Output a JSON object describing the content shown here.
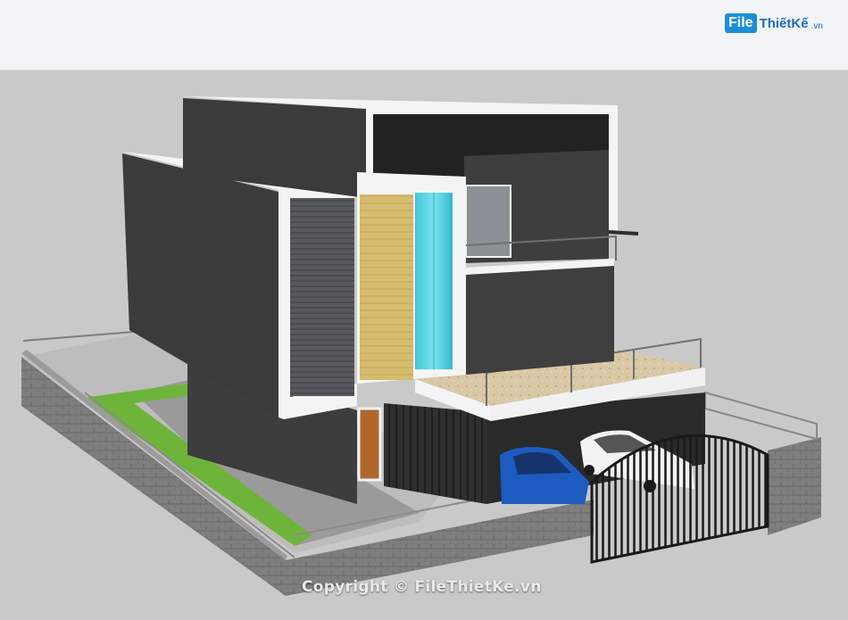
{
  "logo": {
    "box": "File",
    "name": "ThiếtKế",
    "suffix": ".vn"
  },
  "watermark": "Copyright © FileThietKe.vn",
  "colors": {
    "background": "#c9c9c9",
    "wall_dark": "#3d3d3d",
    "frame_white": "#f4f4f4",
    "lawn_green": "#6fb43a",
    "glass_cyan": "#4fd0e0",
    "wood_panel": "#d8bf72",
    "car_blue": "#1d5bc0",
    "car_white": "#f2f2f2",
    "boundary_stone": "#7c7c7c"
  }
}
